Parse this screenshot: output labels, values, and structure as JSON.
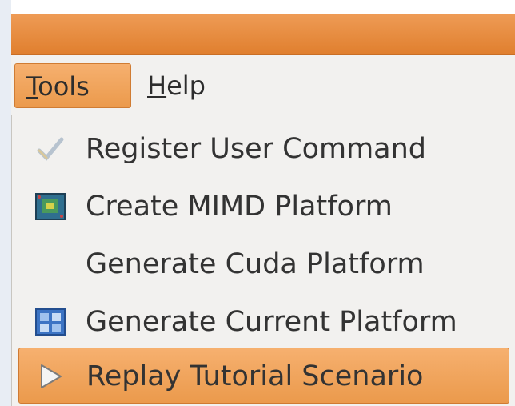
{
  "menubar": {
    "tools": {
      "label": "Tools",
      "mnemonic": "T",
      "rest": "ools"
    },
    "help": {
      "label": "Help",
      "mnemonic": "H",
      "rest": "elp"
    }
  },
  "tools_menu": {
    "items": [
      {
        "label": "Register User Command",
        "icon": "checkmark-icon"
      },
      {
        "label": "Create MIMD Platform",
        "icon": "chip-board-icon"
      },
      {
        "label": "Generate Cuda Platform",
        "icon": null
      },
      {
        "label": "Generate Current Platform",
        "icon": "platform-grid-icon"
      },
      {
        "label": "Replay Tutorial Scenario",
        "icon": "play-triangle-icon",
        "selected": true
      }
    ]
  },
  "colors": {
    "accent": "#eb9a4c",
    "titlebar": "#e07f2e",
    "menu_bg": "#f2f1ef",
    "text": "#333333"
  }
}
